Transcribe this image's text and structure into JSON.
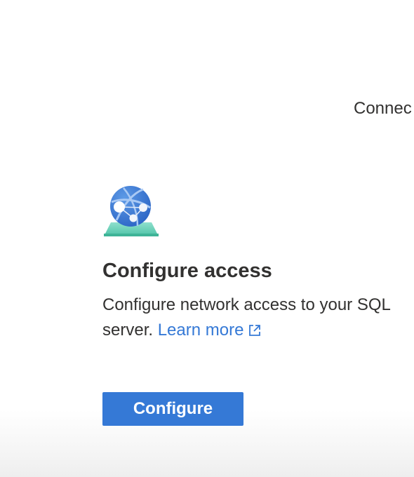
{
  "tabs": {
    "connect_label": "Connec"
  },
  "card": {
    "illustration_icon": "globe-network-icon",
    "title": "Configure access",
    "description": "Configure network access to your SQL server.",
    "learn_more_label": "Learn more",
    "learn_more_icon": "external-link-icon",
    "button_label": "Configure"
  },
  "colors": {
    "accent": "#3579d6",
    "text": "#323130",
    "globe_blue": "#2f6fcf",
    "globe_light": "#8fb9f0",
    "base_teal": "#57c9b0"
  }
}
